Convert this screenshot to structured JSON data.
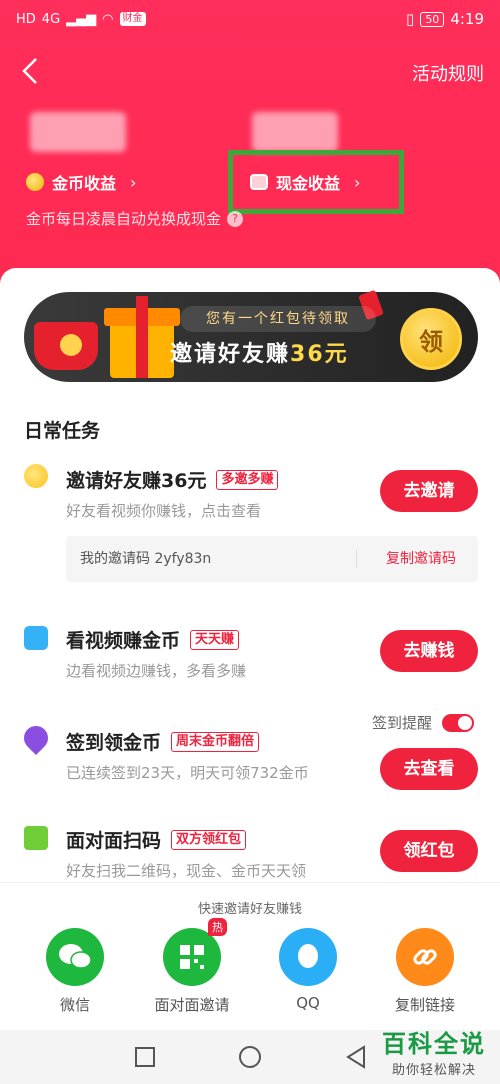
{
  "status_bar": {
    "left_indicators": [
      "HD",
      "4G"
    ],
    "chip": "财金",
    "battery": "50",
    "time": "4:19"
  },
  "header": {
    "rules_link": "活动规则",
    "gold_earnings_label": "金币收益",
    "cash_earnings_label": "现金收益",
    "note": "金币每日凌晨自动兑换成现金",
    "help_icon": "?"
  },
  "banner": {
    "pill_text": "您有一个红包待领取",
    "title_prefix": "邀请好友赚",
    "title_amount": "36元",
    "claim_label": "领"
  },
  "daily_tasks": {
    "section_title": "日常任务",
    "items": [
      {
        "title": "邀请好友赚36元",
        "tag": "多邀多赚",
        "subtitle": "好友看视频你赚钱，点击查看",
        "button": "去邀请",
        "icon": "coin-icon",
        "icon_color": "#ffc21a"
      },
      {
        "title": "看视频赚金币",
        "tag": "天天赚",
        "subtitle": "边看视频边赚钱，多看多赚",
        "button": "去赚钱",
        "icon": "tv-icon",
        "icon_color": "#35b1f5"
      },
      {
        "title": "签到领金币",
        "tag": "周末金币翻倍",
        "subtitle": "已连续签到23天，明天可领732金币",
        "button": "去查看",
        "icon": "location-pin-icon",
        "icon_color": "#8a4fe0"
      },
      {
        "title": "面对面扫码",
        "tag": "双方领红包",
        "subtitle": "好友扫我二维码，现金、金币天天领",
        "button": "领红包",
        "icon": "scan-icon",
        "icon_color": "#6fce37"
      }
    ],
    "invite_code_label": "我的邀请码 2yfy83n",
    "copy_invite_code": "复制邀请码",
    "checkin_reminder_label": "签到提醒"
  },
  "share": {
    "title": "快速邀请好友赚钱",
    "hot_badge": "热",
    "items": [
      {
        "label": "微信",
        "icon": "wechat-icon",
        "color": "#1fb83f"
      },
      {
        "label": "面对面邀请",
        "icon": "qr-code-icon",
        "color": "#1fb83f"
      },
      {
        "label": "QQ",
        "icon": "qq-icon",
        "color": "#2aaef5"
      },
      {
        "label": "复制链接",
        "icon": "link-icon",
        "color": "#ff8a1a"
      }
    ]
  },
  "watermark": {
    "title": "百科全说",
    "subtitle": "助你轻松解决"
  },
  "colors": {
    "brand_red": "#f0233f",
    "header_red": "#ff2b55",
    "highlight_green": "#3ea73a"
  }
}
